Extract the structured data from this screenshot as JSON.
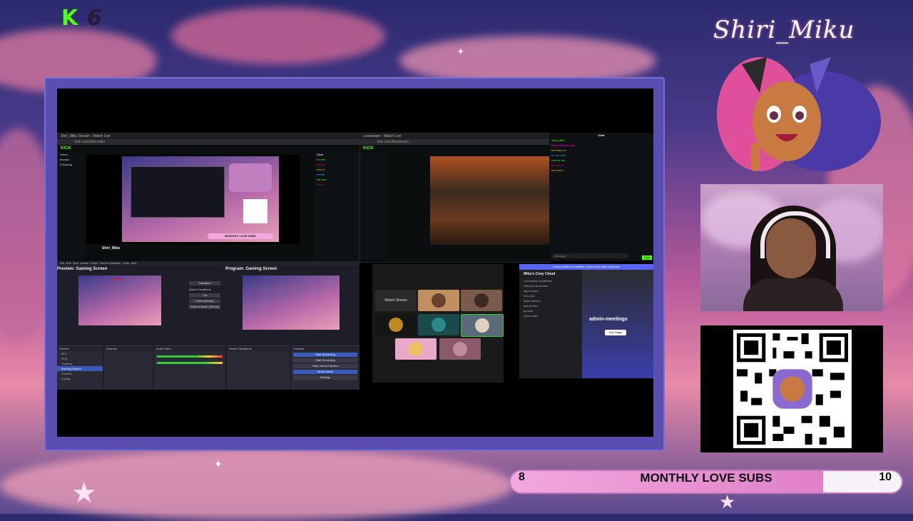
{
  "overlay": {
    "logo": "K",
    "logo_count": "6",
    "brand_name": "Shiri_Miku",
    "goal": {
      "label": "MONTHLY LOVE SUBS",
      "current": "8",
      "target": "10",
      "progress": 0.8
    }
  },
  "colors": {
    "kick_green": "#53fc18",
    "goal_fill": "#e080c8",
    "frame": "#5a4fb0",
    "discord_blurple": "#5865f2"
  },
  "screen": {
    "left_browser": {
      "tab": "Shiri_Miku Stream - Watch Live",
      "url": "kick.com/shiri-miku",
      "site": "KICK",
      "nav": [
        "Home",
        "Browse",
        "Following"
      ],
      "streamer": "Shiri_Miku",
      "chat_title": "Chat",
      "goal_mini": "MONTHLY LOVE SUBS"
    },
    "right_browser": {
      "tab": "Livestream - Watch Live",
      "url": "kick.com/livestream",
      "site": "KICK",
      "chat_title": "Chat"
    },
    "chat_panel": {
      "title": "Chat",
      "lines": [
        "Shiri_Miku",
        "Remote Moderator",
        "Follow",
        "Reply",
        "Message",
        "Chat"
      ]
    },
    "obs": {
      "preview_label": "Preview: Gaming Screen",
      "program_label": "Program: Gaming Screen",
      "menu": [
        "File",
        "Edit",
        "View",
        "Docks",
        "Profile",
        "Scene Collection",
        "Tools",
        "Help"
      ],
      "transition": "Transition",
      "quick_transitions": "Quick Transitions",
      "transition_items": [
        "Cut",
        "Fade (300ms)",
        "Fade to Black (300ms)"
      ],
      "docks": [
        "Scenes",
        "Sources",
        "Audio Mixer",
        "Scene Transitions",
        "Controls"
      ],
      "controls": [
        "Start Streaming",
        "Start Recording",
        "Start Virtual Camera",
        "Studio Mode",
        "Settings"
      ],
      "scenes": [
        "MIX",
        "King",
        "Chatting",
        "Gaming Screen",
        "Zoomed",
        "Ending"
      ],
      "dimension": "278 px"
    },
    "call": {
      "label": "Watch Stream"
    },
    "discord": {
      "banner": "Discord Nitro is available. Learn more here and now!",
      "server": "Miku's Cozy Cloud",
      "channels": [
        "Community Guidelines",
        "welcome-and-rules",
        "hype-snaps",
        "text-chat",
        "twitch-stream",
        "kick-stream",
        "general",
        "voice-lobby"
      ],
      "channel_title": "admin-meetings",
      "button": "Join Stage"
    }
  }
}
